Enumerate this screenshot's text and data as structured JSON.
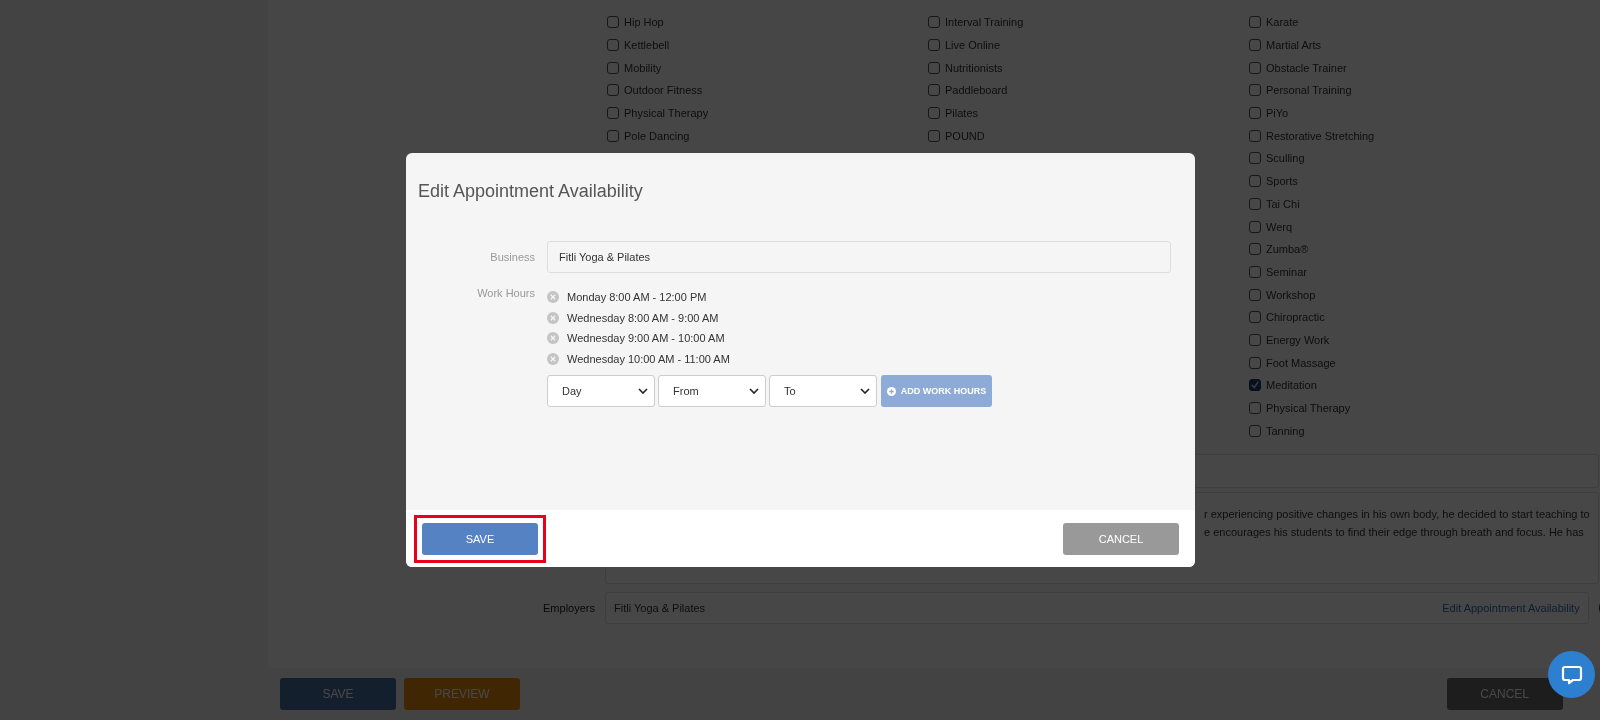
{
  "background": {
    "category_columns": [
      {
        "items": [
          {
            "label": "Hip Hop",
            "checked": false
          },
          {
            "label": "Kettlebell",
            "checked": false
          },
          {
            "label": "Mobility",
            "checked": false
          },
          {
            "label": "Outdoor Fitness",
            "checked": false
          },
          {
            "label": "Physical Therapy",
            "checked": false
          },
          {
            "label": "Pole Dancing",
            "checked": false
          }
        ]
      },
      {
        "items": [
          {
            "label": "Interval Training",
            "checked": false
          },
          {
            "label": "Live Online",
            "checked": false
          },
          {
            "label": "Nutritionists",
            "checked": false
          },
          {
            "label": "Paddleboard",
            "checked": false
          },
          {
            "label": "Pilates",
            "checked": false
          },
          {
            "label": "POUND",
            "checked": false
          }
        ]
      },
      {
        "items": [
          {
            "label": "Karate",
            "checked": false
          },
          {
            "label": "Martial Arts",
            "checked": false
          },
          {
            "label": "Obstacle Trainer",
            "checked": false
          },
          {
            "label": "Personal Training",
            "checked": false
          },
          {
            "label": "PiYo",
            "checked": false
          },
          {
            "label": "Restorative Stretching",
            "checked": false
          },
          {
            "label": "Sculling",
            "checked": false
          },
          {
            "label": "Sports",
            "checked": false
          },
          {
            "label": "Tai Chi",
            "checked": false
          },
          {
            "label": "Werq",
            "checked": false
          },
          {
            "label": "Zumba®",
            "checked": false
          },
          {
            "label": "Seminar",
            "checked": false
          },
          {
            "label": "Workshop",
            "checked": false
          },
          {
            "label": "Chiropractic",
            "checked": false
          },
          {
            "label": "Energy Work",
            "checked": false
          },
          {
            "label": "Foot Massage",
            "checked": false
          },
          {
            "label": "Meditation",
            "checked": true
          },
          {
            "label": "Physical Therapy",
            "checked": false
          },
          {
            "label": "Tanning",
            "checked": false
          }
        ]
      }
    ],
    "bio_lines": [
      "r experiencing positive changes in his own body, he decided to start teaching to",
      "e encourages his students to find their edge through breath and focus. He has"
    ],
    "employers": {
      "label": "Employers",
      "value": "Fitli Yoga & Pilates",
      "link": "Edit Appointment Availability"
    },
    "buttons": [
      {
        "label": "SAVE",
        "kind": "primary"
      },
      {
        "label": "PREVIEW",
        "kind": "preview"
      },
      {
        "label": "CANCEL",
        "kind": "cancel"
      }
    ]
  },
  "modal": {
    "title": "Edit Appointment Availability",
    "business": {
      "label": "Business",
      "value": "Fitli Yoga & Pilates"
    },
    "work_hours": {
      "label": "Work Hours",
      "entries": [
        "Monday 8:00 AM - 12:00 PM",
        "Wednesday 8:00 AM - 9:00 AM",
        "Wednesday 9:00 AM - 10:00 AM",
        "Wednesday 10:00 AM - 11:00 AM"
      ],
      "selects": [
        "Day",
        "From",
        "To"
      ],
      "add_button": "ADD WORK HOURS"
    },
    "save_button": {
      "label": "SAVE",
      "highlighted": true
    },
    "cancel_button": "CANCEL"
  }
}
